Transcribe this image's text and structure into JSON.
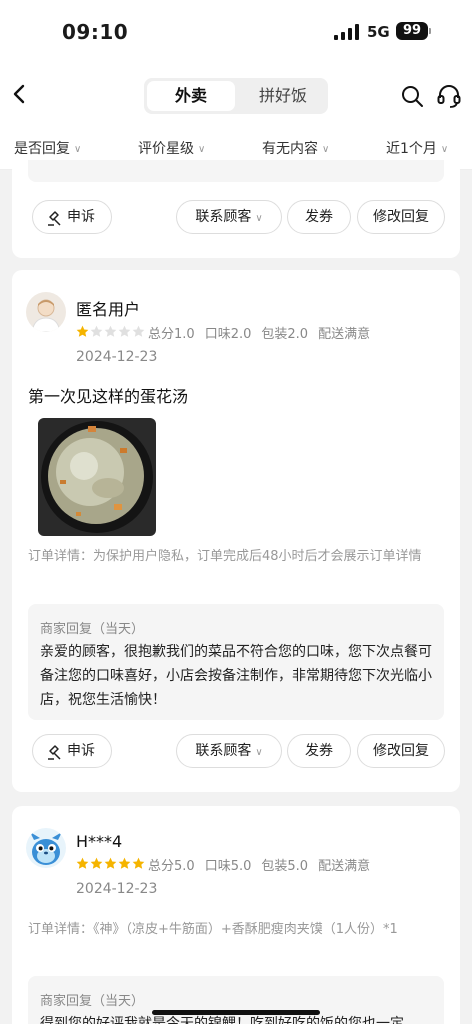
{
  "status_bar": {
    "time": "09:10",
    "network": "5G",
    "battery": "99"
  },
  "nav": {
    "tab_active": "外卖",
    "tab_inactive": "拼好饭"
  },
  "filters": [
    {
      "label": "是否回复"
    },
    {
      "label": "评价星级"
    },
    {
      "label": "有无内容"
    },
    {
      "label": "近1个月"
    }
  ],
  "actions": {
    "appeal": "申诉",
    "contact": "联系顾客",
    "coupon": "发券",
    "edit_reply": "修改回复"
  },
  "reviews": [
    {
      "user": "匿名用户",
      "stars": 1,
      "total": "总分1.0",
      "taste": "口味2.0",
      "package": "包装2.0",
      "delivery": "配送满意",
      "date": "2024-12-23",
      "content": "第一次见这样的蛋花汤",
      "order_detail": "订单详情：为保护用户隐私，订单完成后48小时后才会展示订单详情",
      "reply_title": "商家回复（当天）",
      "reply_text": "亲爱的顾客，很抱歉我们的菜品不符合您的口味，您下次点餐可备注您的口味喜好，小店会按备注制作，非常期待您下次光临小店，祝您生活愉快！"
    },
    {
      "user": "H***4",
      "stars": 5,
      "total": "总分5.0",
      "taste": "口味5.0",
      "package": "包装5.0",
      "delivery": "配送满意",
      "date": "2024-12-23",
      "order_detail": "订单详情：《神》（凉皮+牛筋面）+香酥肥瘦肉夹馍（1人份）*1",
      "reply_title": "商家回复（当天）",
      "reply_text": "得到您的好评我就是今天的锦鲤！吃到好吃的饭的您也一定"
    }
  ],
  "colors": {
    "star_on": "#f5b400",
    "star_off": "#e0e0e0",
    "bg": "#f2f2f2"
  }
}
